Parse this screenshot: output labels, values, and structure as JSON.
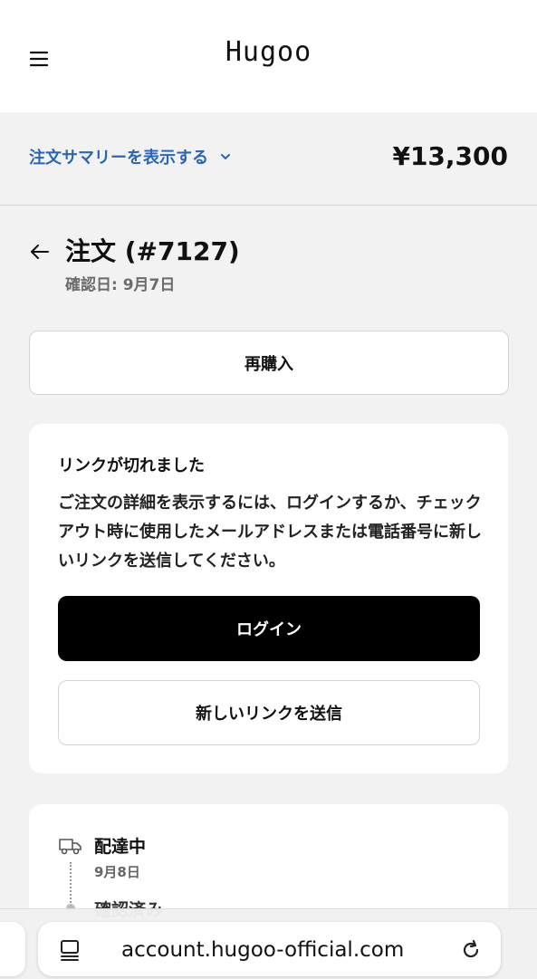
{
  "header": {
    "logo": "Hugoo"
  },
  "summary": {
    "toggle_label": "注文サマリーを表示する",
    "total": "¥13,300"
  },
  "order": {
    "title": "注文 (#7127)",
    "confirmed": "確認日: 9月7日"
  },
  "actions": {
    "reorder": "再購入"
  },
  "link_card": {
    "title": "リンクが切れました",
    "body": "ご注文の詳細を表示するには、ログインするか、チェックアウト時に使用したメールアドレスまたは電話番号に新しいリンクを送信してください。",
    "login": "ログイン",
    "send_link": "新しいリンクを送信"
  },
  "timeline": {
    "status": "配達中",
    "date": "9月8日",
    "next_status": "確認済み"
  },
  "browser": {
    "url": "account.hugoo-official.com"
  },
  "colors": {
    "accent_link": "#2a66b8",
    "primary_button": "#000000"
  },
  "icons": [
    "menu-icon",
    "chevron-down-icon",
    "back-arrow-icon",
    "delivery-truck-icon",
    "page-icon",
    "reload-icon"
  ]
}
